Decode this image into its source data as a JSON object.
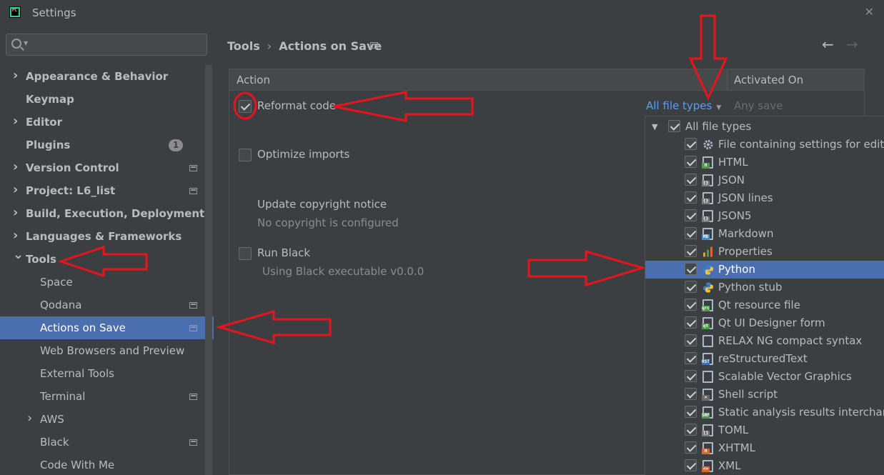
{
  "window": {
    "title": "Settings",
    "close_symbol": "✕"
  },
  "sidebar": {
    "search_placeholder": "",
    "items": [
      {
        "label": "Appearance & Behavior",
        "level": 0,
        "bold": true,
        "chevron": "right"
      },
      {
        "label": "Keymap",
        "level": 0,
        "bold": true,
        "chevron": "none"
      },
      {
        "label": "Editor",
        "level": 0,
        "bold": true,
        "chevron": "right"
      },
      {
        "label": "Plugins",
        "level": 0,
        "bold": true,
        "chevron": "none",
        "badge": "1"
      },
      {
        "label": "Version Control",
        "level": 0,
        "bold": true,
        "chevron": "right",
        "project_icon": true
      },
      {
        "label": "Project: L6_list",
        "level": 0,
        "bold": true,
        "chevron": "right",
        "project_icon": true
      },
      {
        "label": "Build, Execution, Deployment",
        "level": 0,
        "bold": true,
        "chevron": "right"
      },
      {
        "label": "Languages & Frameworks",
        "level": 0,
        "bold": true,
        "chevron": "right"
      },
      {
        "label": "Tools",
        "level": 0,
        "bold": true,
        "chevron": "down"
      },
      {
        "label": "Space",
        "level": 1,
        "bold": false,
        "chevron": "none"
      },
      {
        "label": "Qodana",
        "level": 1,
        "bold": false,
        "chevron": "none",
        "project_icon": true
      },
      {
        "label": "Actions on Save",
        "level": 1,
        "bold": false,
        "chevron": "none",
        "project_icon": true,
        "selected": true
      },
      {
        "label": "Web Browsers and Preview",
        "level": 1,
        "bold": false,
        "chevron": "none"
      },
      {
        "label": "External Tools",
        "level": 1,
        "bold": false,
        "chevron": "none"
      },
      {
        "label": "Terminal",
        "level": 1,
        "bold": false,
        "chevron": "none",
        "project_icon": true
      },
      {
        "label": "AWS",
        "level": 1,
        "bold": false,
        "chevron": "right"
      },
      {
        "label": "Black",
        "level": 1,
        "bold": false,
        "chevron": "none",
        "project_icon": true
      },
      {
        "label": "Code With Me",
        "level": 1,
        "bold": false,
        "chevron": "none"
      }
    ]
  },
  "main": {
    "breadcrumb": {
      "parent": "Tools",
      "separator": "›",
      "current": "Actions on Save"
    },
    "back_symbol": "←",
    "forward_symbol": "→",
    "table": {
      "col_action": "Action",
      "col_activated": "Activated On",
      "rows": {
        "reformat": {
          "label": "Reformat code",
          "checked": true,
          "file_types": "All file types",
          "activated": "Any save"
        },
        "optimize": {
          "label": "Optimize imports",
          "checked": false
        },
        "copyright": {
          "label": "Update copyright notice",
          "sub": "No copyright is configured"
        },
        "black": {
          "label": "Run Black",
          "checked": false,
          "sub": "Using Black executable v0.0.0"
        }
      }
    }
  },
  "popup": {
    "root": "All file types",
    "items": [
      {
        "label": "File containing settings for editor",
        "icon": "gear-icon",
        "tag": "",
        "tag_color": ""
      },
      {
        "label": "HTML",
        "icon": "html-file-icon",
        "tag": "H",
        "tag_color": "#4a9c4a"
      },
      {
        "label": "JSON",
        "icon": "json-file-icon",
        "tag": "{}",
        "tag_color": "#7a7a7a"
      },
      {
        "label": "JSON lines",
        "icon": "json-file-icon",
        "tag": "{}",
        "tag_color": "#7a7a7a"
      },
      {
        "label": "JSON5",
        "icon": "json-file-icon",
        "tag": "{}",
        "tag_color": "#7a7a7a"
      },
      {
        "label": "Markdown",
        "icon": "markdown-file-icon",
        "tag": "MD",
        "tag_color": "#3d8fd1"
      },
      {
        "label": "Properties",
        "icon": "properties-file-icon",
        "tag": "",
        "tag_color": ""
      },
      {
        "label": "Python",
        "icon": "python-icon",
        "tag": "",
        "tag_color": "",
        "selected": true
      },
      {
        "label": "Python stub",
        "icon": "python-stub-icon",
        "tag": "",
        "tag_color": ""
      },
      {
        "label": "Qt resource file",
        "icon": "qt-resource-icon",
        "tag": "qrc",
        "tag_color": "#4a9c4a"
      },
      {
        "label": "Qt UI Designer form",
        "icon": "qt-ui-icon",
        "tag": "qt",
        "tag_color": "#4a9c4a"
      },
      {
        "label": "RELAX NG compact syntax",
        "icon": "relax-ng-icon",
        "tag": "",
        "tag_color": ""
      },
      {
        "label": "reStructuredText",
        "icon": "rst-file-icon",
        "tag": "RST",
        "tag_color": "#3d6fb0"
      },
      {
        "label": "Scalable Vector Graphics",
        "icon": "svg-file-icon",
        "tag": "",
        "tag_color": ""
      },
      {
        "label": "Shell script",
        "icon": "shell-script-icon",
        "tag": ">",
        "tag_color": "#6b6b6b"
      },
      {
        "label": "Static analysis results interchange",
        "icon": "sarif-file-icon",
        "tag": "SRF",
        "tag_color": "#4a9c4a"
      },
      {
        "label": "TOML",
        "icon": "toml-file-icon",
        "tag": "[]",
        "tag_color": "#7a7a7a"
      },
      {
        "label": "XHTML",
        "icon": "xhtml-file-icon",
        "tag": "H",
        "tag_color": "#d96a2b"
      },
      {
        "label": "XML",
        "icon": "xml-file-icon",
        "tag": "<>",
        "tag_color": "#d96a2b"
      }
    ]
  },
  "colors": {
    "accent": "#4b6eaf",
    "link": "#589df6",
    "annotation": "#e8141c"
  }
}
